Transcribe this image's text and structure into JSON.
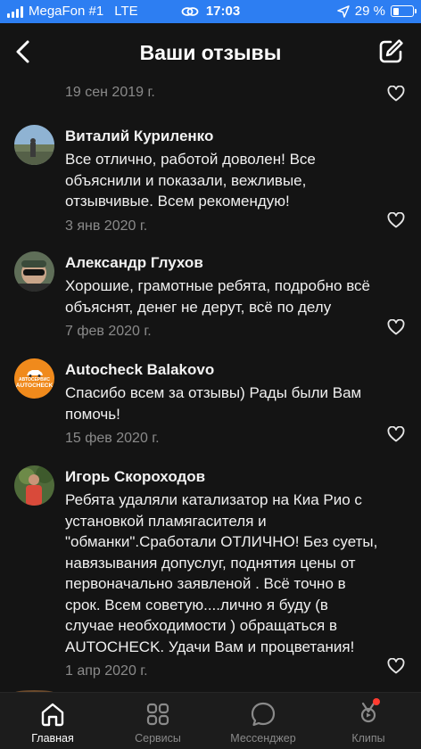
{
  "status_bar": {
    "carrier": "MegaFon #1",
    "network": "LTE",
    "time": "17:03",
    "battery": "29 %",
    "battery_level": 0.29
  },
  "header": {
    "title": "Ваши отзывы",
    "back_icon": "chevron-left-icon",
    "edit_icon": "compose-icon"
  },
  "reviews": [
    {
      "author": "",
      "text": "",
      "date": "19 сен 2019 г."
    },
    {
      "author": "Виталий Куриленко",
      "text_lines": [
        "Все отлично, работой доволен! Все",
        "объяснили и показали, вежливые,",
        "отзывчивые. Всем рекомендую!"
      ],
      "date": "3 янв 2020 г."
    },
    {
      "author": "Александр Глухов",
      "text_lines": [
        "Хорошие, грамотные ребята, подробно всё",
        "объяснят, денег не дерут, всё по делу"
      ],
      "date": "7 фев 2020 г."
    },
    {
      "author": "Autocheck Balakovo",
      "avatar_text": "AUTOCHECK",
      "avatar_top_text": "АВТОСЕРВИС",
      "text_lines": [
        "Спасибо всем за отзывы) Рады были Вам",
        "помочь!"
      ],
      "date": "15 фев 2020 г."
    },
    {
      "author": "Игорь Скороходов",
      "text_lines": [
        "Ребята удаляли катализатор на Киа Рио с",
        "установкой пламягасителя и",
        "\"обманки\".Сработали ОТЛИЧНО! Без суеты,",
        "навязывания допуслуг, поднятия цены от",
        "первоначально заявленой . Всё точно в",
        "срок. Всем советую....лично я буду  (в",
        "случае  необходимости ) обращаться  в",
        "AUTOCHECK. Удачи Вам и процветания!"
      ],
      "date": "1 апр 2020 г."
    }
  ],
  "tabbar": {
    "items": [
      {
        "label": "Главная",
        "icon": "home-icon",
        "active": true
      },
      {
        "label": "Сервисы",
        "icon": "grid-icon",
        "active": false
      },
      {
        "label": "Мессенджер",
        "icon": "chat-bubble-icon",
        "active": false
      },
      {
        "label": "Клипы",
        "icon": "clips-icon",
        "active": false,
        "badge": true
      }
    ]
  },
  "colors": {
    "status_bar_bg": "#2d7ef2",
    "background": "#141414",
    "tabbar_bg": "#1c1c1c",
    "muted_text": "#8a8a8a",
    "badge": "#ff3b30",
    "avatar_orange": "#f08a1c"
  }
}
